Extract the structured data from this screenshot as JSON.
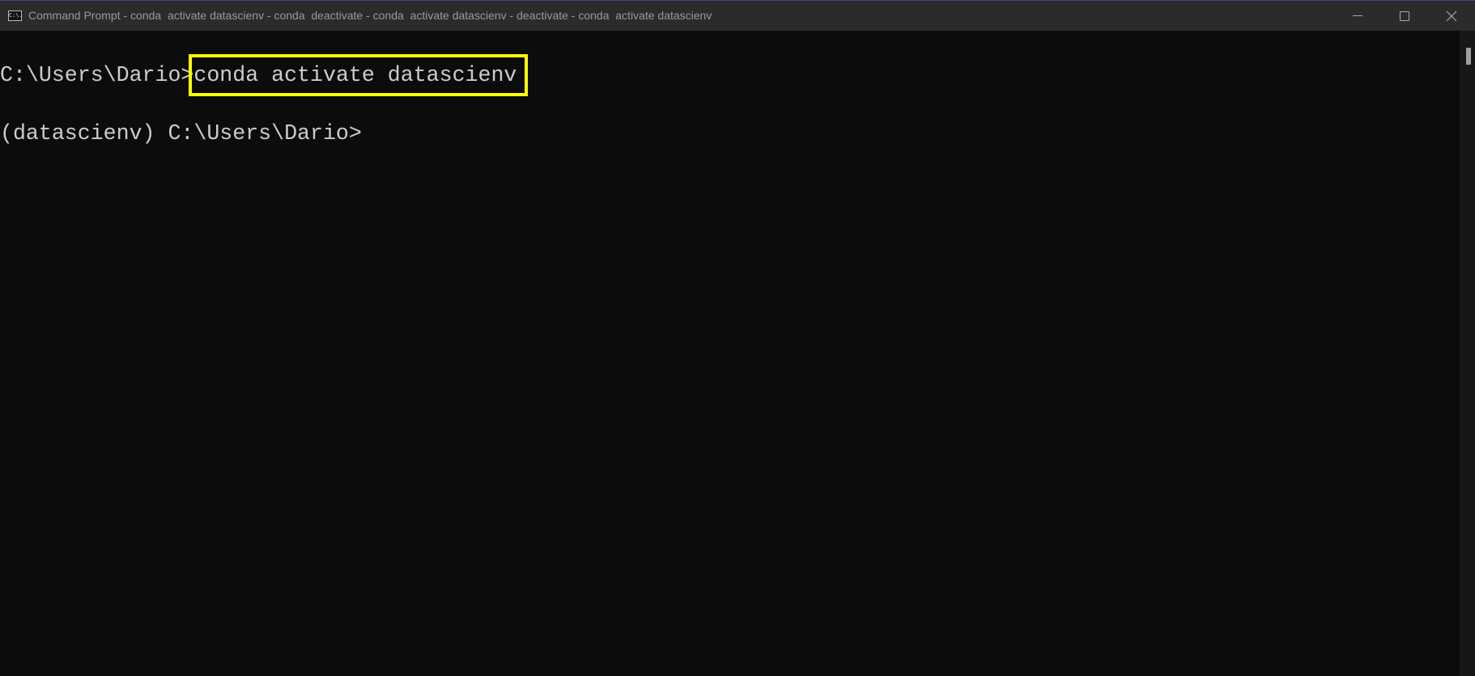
{
  "window": {
    "title": "Command Prompt - conda  activate datascienv - conda  deactivate - conda  activate datascienv - deactivate - conda  activate datascienv",
    "icon": "cmd-icon",
    "icon_text": "C:\\."
  },
  "terminal": {
    "lines": [
      {
        "prompt": "C:\\Users\\Dario>",
        "command": "conda activate datascienv"
      },
      {
        "prompt": "(datascienv) C:\\Users\\Dario>",
        "command": ""
      }
    ],
    "highlight_color": "#ffff00"
  }
}
